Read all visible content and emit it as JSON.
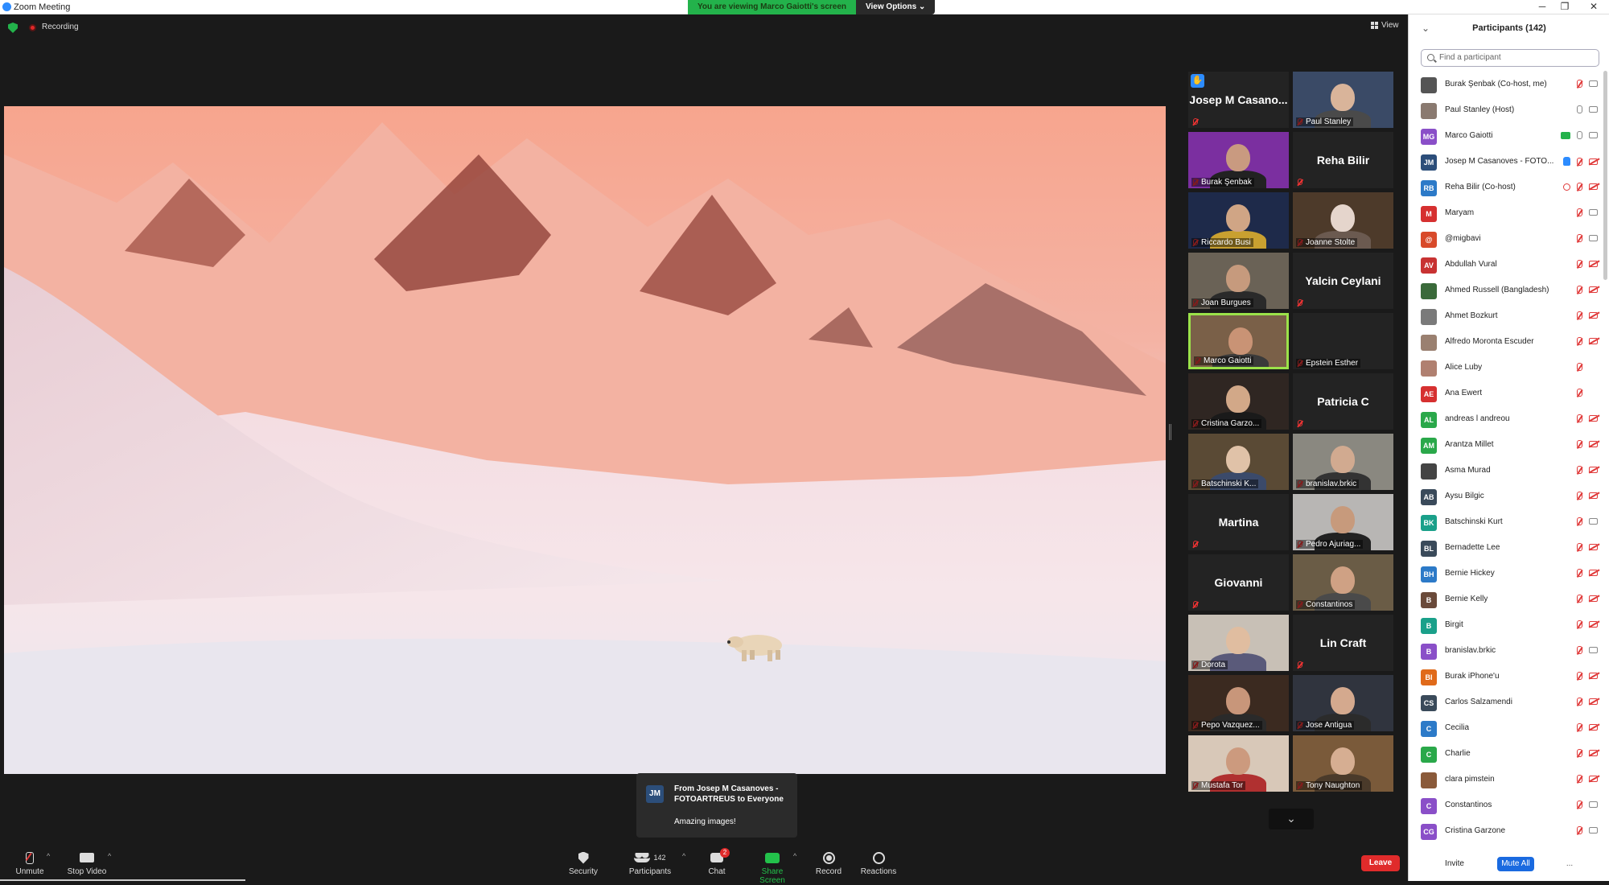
{
  "window": {
    "title": "Zoom Meeting",
    "minimize": "─",
    "restore": "❐",
    "close": "✕"
  },
  "banner": {
    "message": "You are viewing Marco Gaiotti's screen",
    "view_options": "View Options ⌄"
  },
  "stage": {
    "recording_label": "Recording",
    "view_label": "View"
  },
  "gallery": {
    "tiles": [
      {
        "name": "Josep  M  Casano...",
        "label": "",
        "type": "name",
        "hand": true
      },
      {
        "name": "",
        "label": "Paul Stanley",
        "type": "video",
        "bg": "#3a4a66",
        "skin": "#d9b49a",
        "shirt": "#4a4a4a"
      },
      {
        "name": "",
        "label": "Burak Şenbak",
        "type": "video",
        "bg": "#7b2fa0",
        "skin": "#c99a80",
        "shirt": "#222"
      },
      {
        "name": "Reha Bilir",
        "label": "",
        "type": "name"
      },
      {
        "name": "",
        "label": "Riccardo Busi",
        "type": "video",
        "bg": "#1e2a4a",
        "skin": "#d0a585",
        "shirt": "#c9a030"
      },
      {
        "name": "",
        "label": "Joanne Stolte",
        "type": "video",
        "bg": "#4d3a2a",
        "skin": "#e5d5cc",
        "shirt": "#6b5a50"
      },
      {
        "name": "",
        "label": "Joan Burgues",
        "type": "video",
        "bg": "#6a6256",
        "skin": "#c69a7d",
        "shirt": "#2a2a2a"
      },
      {
        "name": "Yalcin Ceylani",
        "label": "",
        "type": "name"
      },
      {
        "name": "",
        "label": "Marco Gaiotti",
        "type": "video",
        "bg": "#7a6048",
        "skin": "#c99375",
        "shirt": "#3a3a3a",
        "active": true
      },
      {
        "name": "",
        "label": "Epstein Esther",
        "type": "name"
      },
      {
        "name": "",
        "label": "Cristina Garzo...",
        "type": "video",
        "bg": "#2f2622",
        "skin": "#d2a888",
        "shirt": "#1a1a1a"
      },
      {
        "name": "Patricia C",
        "label": "",
        "type": "name"
      },
      {
        "name": "",
        "label": "Batschinski K...",
        "type": "video",
        "bg": "#5a4a35",
        "skin": "#e0c2a8",
        "shirt": "#3b4a6a"
      },
      {
        "name": "",
        "label": "branislav.brkic",
        "type": "video",
        "bg": "#8a8880",
        "skin": "#d1aa90",
        "shirt": "#333"
      },
      {
        "name": "Martina",
        "label": "",
        "type": "name"
      },
      {
        "name": "",
        "label": "Pedro Ajuriag...",
        "type": "video",
        "bg": "#b8b6b4",
        "skin": "#c79a7c",
        "shirt": "#222"
      },
      {
        "name": "Giovanni",
        "label": "",
        "type": "name"
      },
      {
        "name": "",
        "label": "Constantinos",
        "type": "video",
        "bg": "#6a5c46",
        "skin": "#cfa184",
        "shirt": "#4a4a4a"
      },
      {
        "name": "",
        "label": "Dorota",
        "type": "video",
        "bg": "#c8c0b6",
        "skin": "#e0bda0",
        "shirt": "#5a5a7a"
      },
      {
        "name": "Lin Craft",
        "label": "",
        "type": "name"
      },
      {
        "name": "",
        "label": "Pepo Vazquez...",
        "type": "video",
        "bg": "#3b2a20",
        "skin": "#c8967a",
        "shirt": "#2a2a2a"
      },
      {
        "name": "",
        "label": "Jose Antigua",
        "type": "video",
        "bg": "#30343e",
        "skin": "#d4a98e",
        "shirt": "#2b2b2b"
      },
      {
        "name": "",
        "label": "Mustafa Tor",
        "type": "video",
        "bg": "#d8c8b8",
        "skin": "#cc9a7e",
        "shirt": "#b03030"
      },
      {
        "name": "",
        "label": "Tony Naughton",
        "type": "video",
        "bg": "#7a5a3a",
        "skin": "#d6ae92",
        "shirt": "#4a3a2a"
      }
    ],
    "nav_icon": "⌄"
  },
  "chat_toast": {
    "avatar": "JM",
    "from": "From Josep M Casanoves - FOTOARTREUS to Everyone",
    "message": "Amazing images!"
  },
  "toolbar": {
    "unmute": "Unmute",
    "stop_video": "Stop Video",
    "security": "Security",
    "participants": "Participants",
    "participants_count": "142",
    "chat": "Chat",
    "chat_badge": "2",
    "share_screen": "Share Screen",
    "record": "Record",
    "reactions": "Reactions",
    "leave": "Leave",
    "caret": "^"
  },
  "panel": {
    "title": "Participants (142)",
    "search_placeholder": "Find a participant",
    "participants": [
      {
        "name": "Burak Şenbak (Co-host, me)",
        "initials": "",
        "color": "#555",
        "mic": "muted",
        "cam": "on-gray"
      },
      {
        "name": "Paul Stanley (Host)",
        "initials": "",
        "color": "#8a7a70",
        "mic": "open",
        "cam": "on-gray"
      },
      {
        "name": "Marco Gaiotti",
        "initials": "MG",
        "color": "#8a4fc8",
        "mic": "open",
        "cam": "on-gray",
        "share": true
      },
      {
        "name": "Josep M Casanoves - FOTO...",
        "initials": "JM",
        "color": "#2c4e7a",
        "mic": "muted",
        "cam": "off",
        "hand": true
      },
      {
        "name": "Reha Bilir (Co-host)",
        "initials": "RB",
        "color": "#2c7ac8",
        "mic": "muted",
        "cam": "off",
        "rec": true
      },
      {
        "name": " Maryam",
        "initials": "M",
        "color": "#d63030",
        "mic": "muted",
        "cam": "on-gray"
      },
      {
        "name": "@migbavi",
        "initials": "@",
        "color": "#d84a2a",
        "mic": "muted",
        "cam": "on-gray"
      },
      {
        "name": "Abdullah Vural",
        "initials": "AV",
        "color": "#c83232",
        "mic": "muted",
        "cam": "off"
      },
      {
        "name": "Ahmed Russell (Bangladesh)",
        "initials": "",
        "color": "#3a6a3a",
        "mic": "muted",
        "cam": "off"
      },
      {
        "name": "Ahmet Bozkurt",
        "initials": "",
        "color": "#7a7a7a",
        "mic": "muted",
        "cam": "off"
      },
      {
        "name": "Alfredo Moronta Escuder",
        "initials": "",
        "color": "#9a8070",
        "mic": "muted",
        "cam": "off"
      },
      {
        "name": "Alice Luby",
        "initials": "",
        "color": "#b08070",
        "mic": "muted",
        "cam": ""
      },
      {
        "name": "Ana Ewert",
        "initials": "AE",
        "color": "#d63030",
        "mic": "muted",
        "cam": ""
      },
      {
        "name": "andreas l andreou",
        "initials": "AL",
        "color": "#2aa84a",
        "mic": "muted",
        "cam": "off"
      },
      {
        "name": "Arantza Millet",
        "initials": "AM",
        "color": "#2aa84a",
        "mic": "muted",
        "cam": "off"
      },
      {
        "name": "Asma Murad",
        "initials": "",
        "color": "#444",
        "mic": "muted",
        "cam": "off"
      },
      {
        "name": "Aysu Bilgic",
        "initials": "AB",
        "color": "#3a4a5a",
        "mic": "muted",
        "cam": "off"
      },
      {
        "name": "Batschinski Kurt",
        "initials": "BK",
        "color": "#1aa08a",
        "mic": "muted",
        "cam": "on-gray"
      },
      {
        "name": "Bernadette Lee",
        "initials": "BL",
        "color": "#3a4a5a",
        "mic": "muted",
        "cam": "off"
      },
      {
        "name": "Bernie Hickey",
        "initials": "BH",
        "color": "#2c7ac8",
        "mic": "muted",
        "cam": "off"
      },
      {
        "name": "Bernie Kelly",
        "initials": "B",
        "color": "#6a4a3a",
        "mic": "muted",
        "cam": "off"
      },
      {
        "name": "Birgit",
        "initials": "B",
        "color": "#1aa08a",
        "mic": "muted",
        "cam": "off"
      },
      {
        "name": "branislav.brkic",
        "initials": "B",
        "color": "#8a4fc8",
        "mic": "muted",
        "cam": "on-gray"
      },
      {
        "name": "Burak iPhone'u",
        "initials": "BI",
        "color": "#e06a1a",
        "mic": "muted",
        "cam": "off"
      },
      {
        "name": "Carlos Salzamendi",
        "initials": "CS",
        "color": "#3a4a5a",
        "mic": "muted",
        "cam": "off"
      },
      {
        "name": "Cecilia",
        "initials": "C",
        "color": "#2c7ac8",
        "mic": "muted",
        "cam": "off"
      },
      {
        "name": "Charlie",
        "initials": "C",
        "color": "#2aa84a",
        "mic": "muted",
        "cam": "off"
      },
      {
        "name": "clara pimstein",
        "initials": "",
        "color": "#8a5a3a",
        "mic": "muted",
        "cam": "off"
      },
      {
        "name": "Constantinos",
        "initials": "C",
        "color": "#8a4fc8",
        "mic": "muted",
        "cam": "on-gray"
      },
      {
        "name": "Cristina Garzone",
        "initials": "CG",
        "color": "#8a4fc8",
        "mic": "muted",
        "cam": "on-gray"
      }
    ],
    "invite": "Invite",
    "mute_all": "Mute All",
    "more": "..."
  }
}
